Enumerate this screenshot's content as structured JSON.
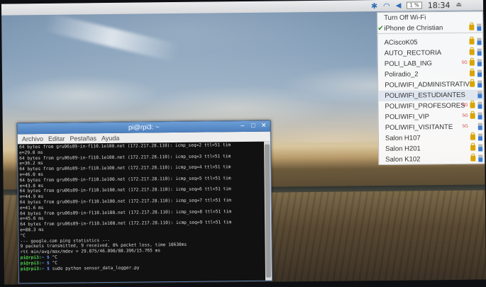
{
  "panel": {
    "icons": [
      "bluetooth-icon",
      "wifi-icon",
      "volume-icon"
    ],
    "cpu": "1 %",
    "clock": "18:34"
  },
  "wifi_menu": {
    "toggle_label": "Turn Off Wi-Fi",
    "connected": "iPhone de Christian",
    "networks": [
      {
        "ssid": "ACiscoK05",
        "locked": true
      },
      {
        "ssid": "AUTO_RECTORIA",
        "locked": true
      },
      {
        "ssid": "POLI_LAB_ING",
        "locked": true,
        "band": "5G"
      },
      {
        "ssid": "Poliradio_2",
        "locked": true
      },
      {
        "ssid": "POLIWIFI_ADMINISTRATIVO",
        "locked": true
      },
      {
        "ssid": "POLIWIFI_ESTUDIANTES",
        "locked": false,
        "highlight": true
      },
      {
        "ssid": "POLIWIFI_PROFESORES",
        "locked": true,
        "band": "5G"
      },
      {
        "ssid": "POLIWIFI_VIP",
        "locked": true,
        "band": "5G"
      },
      {
        "ssid": "POLIWIFI_VISITANTE",
        "locked": false,
        "band": "5G"
      },
      {
        "ssid": "Salon H107",
        "locked": true
      },
      {
        "ssid": "Salon H201",
        "locked": true
      },
      {
        "ssid": "Salon K102",
        "locked": true
      }
    ]
  },
  "terminal": {
    "title": "pi@rpi3: ~",
    "menu": [
      "Archivo",
      "Editar",
      "Pestañas",
      "Ayuda"
    ],
    "lines": [
      {
        "text": "64 bytes from gru06s09-in-f110.1e100.net (172.217.28.110): icmp_seq=2 ttl=51 tim"
      },
      {
        "text": "e=29.8 ms"
      },
      {
        "text": "64 bytes from gru06s09-in-f110.1e100.net (172.217.28.110): icmp_seq=3 ttl=51 tim"
      },
      {
        "text": "e=36.2 ms"
      },
      {
        "text": "64 bytes from gru06s09-in-f110.1e100.net (172.217.28.110): icmp_seq=4 ttl=51 tim"
      },
      {
        "text": "e=46.0 ms"
      },
      {
        "text": "64 bytes from gru06s09-in-f110.1e100.net (172.217.28.110): icmp_seq=5 ttl=51 tim"
      },
      {
        "text": "e=43.8 ms"
      },
      {
        "text": "64 bytes from gru06s09-in-f110.1e100.net (172.217.28.110): icmp_seq=6 ttl=51 tim"
      },
      {
        "text": "e=44.9 ms"
      },
      {
        "text": "64 bytes from gru06s09-in-f110.1e100.net (172.217.28.110): icmp_seq=7 ttl=51 tim"
      },
      {
        "text": "e=41.6 ms"
      },
      {
        "text": "64 bytes from gru06s09-in-f110.1e100.net (172.217.28.110): icmp_seq=8 ttl=51 tim"
      },
      {
        "text": "e=45.6 ms"
      },
      {
        "text": "64 bytes from gru06s09-in-f110.1e100.net (172.217.28.110): icmp_seq=9 ttl=51 tim"
      },
      {
        "text": "e=88.3 ms"
      },
      {
        "text": "^C"
      },
      {
        "text": "--- google.com ping statistics ---"
      },
      {
        "text": "9 packets transmitted, 9 received, 0% packet loss, time 10630ms"
      },
      {
        "text": "rtt min/avg/max/mdev = 29.875/46.090/88.396/15.765 ms"
      },
      {
        "prompt": "pi@rpi3:",
        "path": "~ $",
        "text": " ^C"
      },
      {
        "prompt": "pi@rpi3:",
        "path": "~ $",
        "text": " ^C"
      },
      {
        "prompt": "pi@rpi3:",
        "path": "~ $",
        "text": " sudo python sensor_data_logger.py"
      }
    ]
  }
}
